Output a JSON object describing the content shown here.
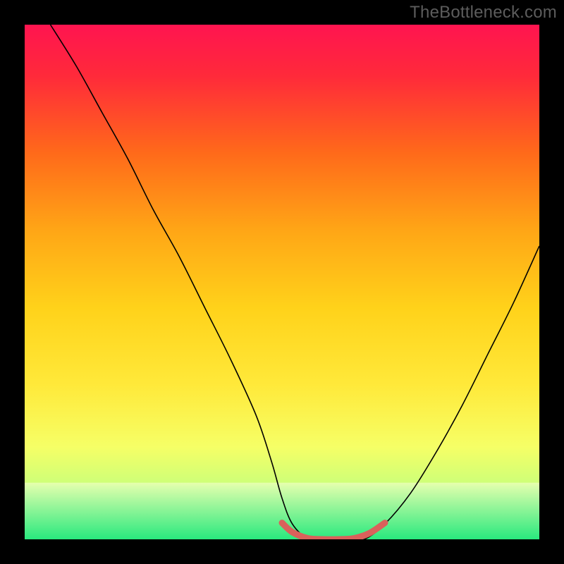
{
  "watermark": "TheBottleneck.com",
  "chart_data": {
    "type": "line",
    "title": "",
    "xlabel": "",
    "ylabel": "",
    "xlim": [
      0,
      100
    ],
    "ylim": [
      0,
      100
    ],
    "background_gradient": {
      "stops": [
        {
          "offset": 0.0,
          "color": "#ff1450"
        },
        {
          "offset": 0.1,
          "color": "#ff2a3a"
        },
        {
          "offset": 0.25,
          "color": "#ff6a1a"
        },
        {
          "offset": 0.4,
          "color": "#ffa616"
        },
        {
          "offset": 0.55,
          "color": "#ffd21a"
        },
        {
          "offset": 0.7,
          "color": "#ffe93a"
        },
        {
          "offset": 0.82,
          "color": "#f6ff66"
        },
        {
          "offset": 0.9,
          "color": "#c9ff7a"
        },
        {
          "offset": 0.96,
          "color": "#7aff9a"
        },
        {
          "offset": 1.0,
          "color": "#27ef7d"
        }
      ]
    },
    "green_band": {
      "ymin": 0,
      "ymax": 11,
      "from_color": "#e6ffae",
      "to_color": "#29e97e"
    },
    "series": [
      {
        "name": "bottleneck-curve",
        "color": "#000000",
        "stroke_width": 1.6,
        "x": [
          5,
          10,
          15,
          20,
          25,
          30,
          35,
          40,
          45,
          48,
          50,
          52,
          55,
          57,
          60,
          63,
          66,
          70,
          75,
          80,
          85,
          90,
          95,
          100
        ],
        "values": [
          100,
          92,
          83,
          74,
          64,
          55,
          45,
          35,
          24,
          15,
          8,
          3,
          0,
          0,
          0,
          0,
          0,
          3,
          9,
          17,
          26,
          36,
          46,
          57
        ]
      },
      {
        "name": "optimal-zone-mark",
        "color": "#d9615b",
        "stroke_width": 9,
        "linecap": "round",
        "x": [
          50,
          52,
          55,
          58,
          61,
          64,
          67,
          70
        ],
        "values": [
          3.2,
          1.4,
          0.2,
          0.0,
          0.0,
          0.2,
          1.2,
          3.2
        ]
      }
    ]
  }
}
